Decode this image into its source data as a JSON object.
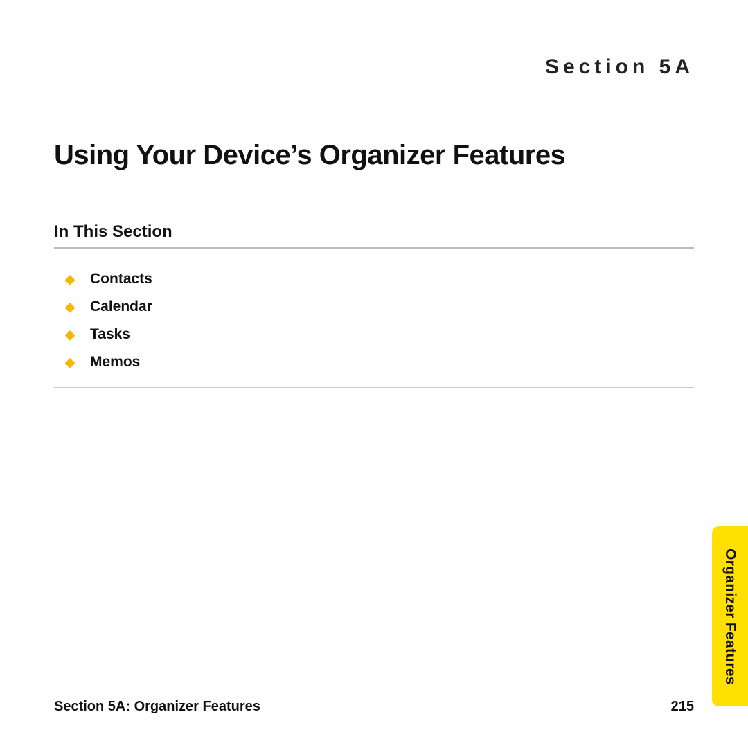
{
  "header": {
    "section_label": "Section 5A"
  },
  "title": "Using Your Device’s Organizer Features",
  "subheading": "In This Section",
  "toc": {
    "items": [
      {
        "label": "Contacts"
      },
      {
        "label": "Calendar"
      },
      {
        "label": "Tasks"
      },
      {
        "label": "Memos"
      }
    ]
  },
  "footer": {
    "left": "Section 5A: Organizer Features",
    "page_number": "215"
  },
  "side_tab": {
    "label": "Organizer Features"
  },
  "colors": {
    "accent": "#ffe000",
    "bullet": "#f2b900"
  }
}
